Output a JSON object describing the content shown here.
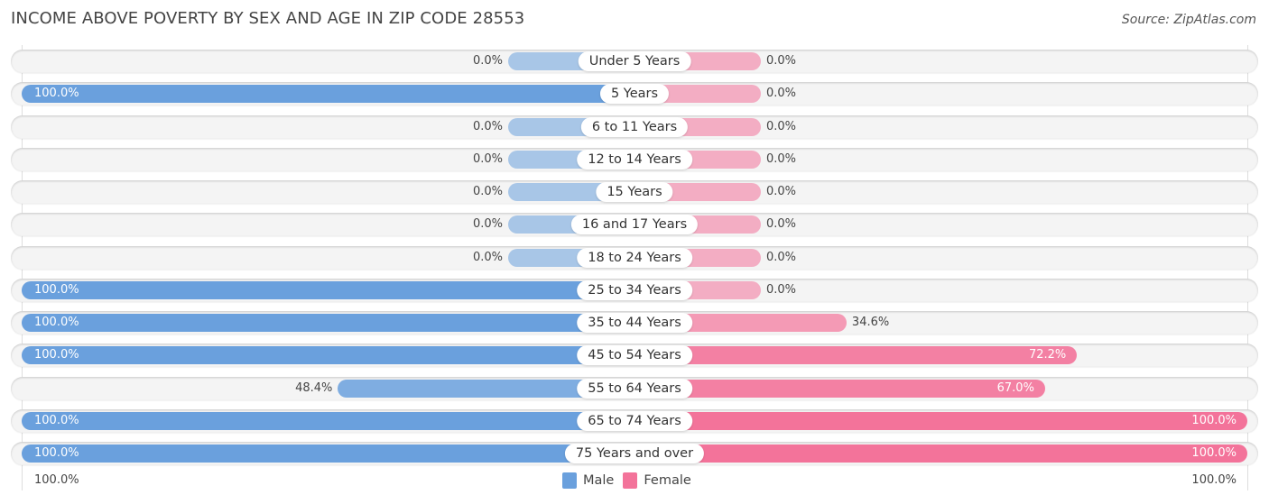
{
  "chart_data": {
    "type": "bar",
    "orientation": "horizontal-diverging",
    "title": "INCOME ABOVE POVERTY BY SEX AND AGE IN ZIP CODE 28553",
    "source": "Source: ZipAtlas.com",
    "categories": [
      "Under 5 Years",
      "5 Years",
      "6 to 11 Years",
      "12 to 14 Years",
      "15 Years",
      "16 and 17 Years",
      "18 to 24 Years",
      "25 to 34 Years",
      "35 to 44 Years",
      "45 to 54 Years",
      "55 to 64 Years",
      "65 to 74 Years",
      "75 Years and over"
    ],
    "series": [
      {
        "name": "Male",
        "color": "#6aa0dd",
        "values": [
          0.0,
          100.0,
          0.0,
          0.0,
          0.0,
          0.0,
          0.0,
          100.0,
          100.0,
          100.0,
          48.4,
          100.0,
          100.0
        ]
      },
      {
        "name": "Female",
        "color": "#f3739a",
        "values": [
          0.0,
          0.0,
          0.0,
          0.0,
          0.0,
          0.0,
          0.0,
          0.0,
          34.6,
          72.2,
          67.0,
          100.0,
          100.0
        ]
      }
    ],
    "value_labels": {
      "male": [
        "0.0%",
        "100.0%",
        "0.0%",
        "0.0%",
        "0.0%",
        "0.0%",
        "0.0%",
        "100.0%",
        "100.0%",
        "100.0%",
        "48.4%",
        "100.0%",
        "100.0%"
      ],
      "female": [
        "0.0%",
        "0.0%",
        "0.0%",
        "0.0%",
        "0.0%",
        "0.0%",
        "0.0%",
        "0.0%",
        "34.6%",
        "72.2%",
        "67.0%",
        "100.0%",
        "100.0%"
      ]
    },
    "xlim": [
      0,
      100
    ],
    "axis_labels": {
      "left": "100.0%",
      "right": "100.0%"
    },
    "legend": {
      "position": "bottom-center",
      "entries": [
        "Male",
        "Female"
      ]
    },
    "grid": false
  }
}
